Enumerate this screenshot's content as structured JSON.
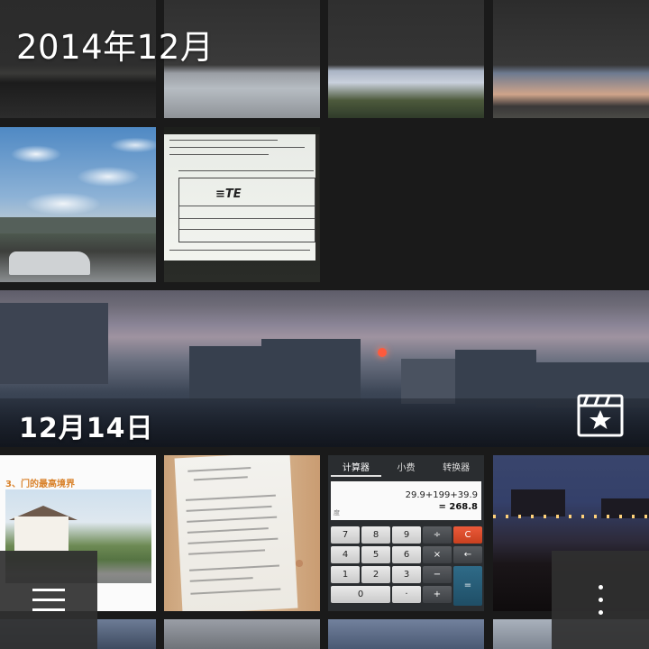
{
  "header": {
    "month_heading": "2014年12月"
  },
  "banner": {
    "date_label": "12月14日"
  },
  "calculator_thumb": {
    "tabs": [
      "计算器",
      "小费",
      "转换器"
    ],
    "expression": "29.9+199+39.9",
    "result": "= 268.8",
    "memory_label": "度",
    "keys": [
      [
        "7",
        "8",
        "9",
        "÷",
        "C"
      ],
      [
        "4",
        "5",
        "6",
        "×",
        "←"
      ],
      [
        "1",
        "2",
        "3",
        "−",
        "="
      ],
      [
        "0",
        "·",
        "+"
      ]
    ]
  },
  "article_thumb": {
    "title": "3、门的最高境界"
  },
  "document_thumb": {
    "logo_text": "≡TE"
  },
  "icons": {
    "menu": "hamburger-menu-icon",
    "more": "vertical-dots-more-icon",
    "movie": "clapperboard-star-icon"
  },
  "colors": {
    "background": "#1a1a1a",
    "overlay_button": "#303030",
    "calc_clear": "#e14a2a",
    "calc_equals": "#2a5f7a",
    "article_accent": "#d9822b"
  }
}
